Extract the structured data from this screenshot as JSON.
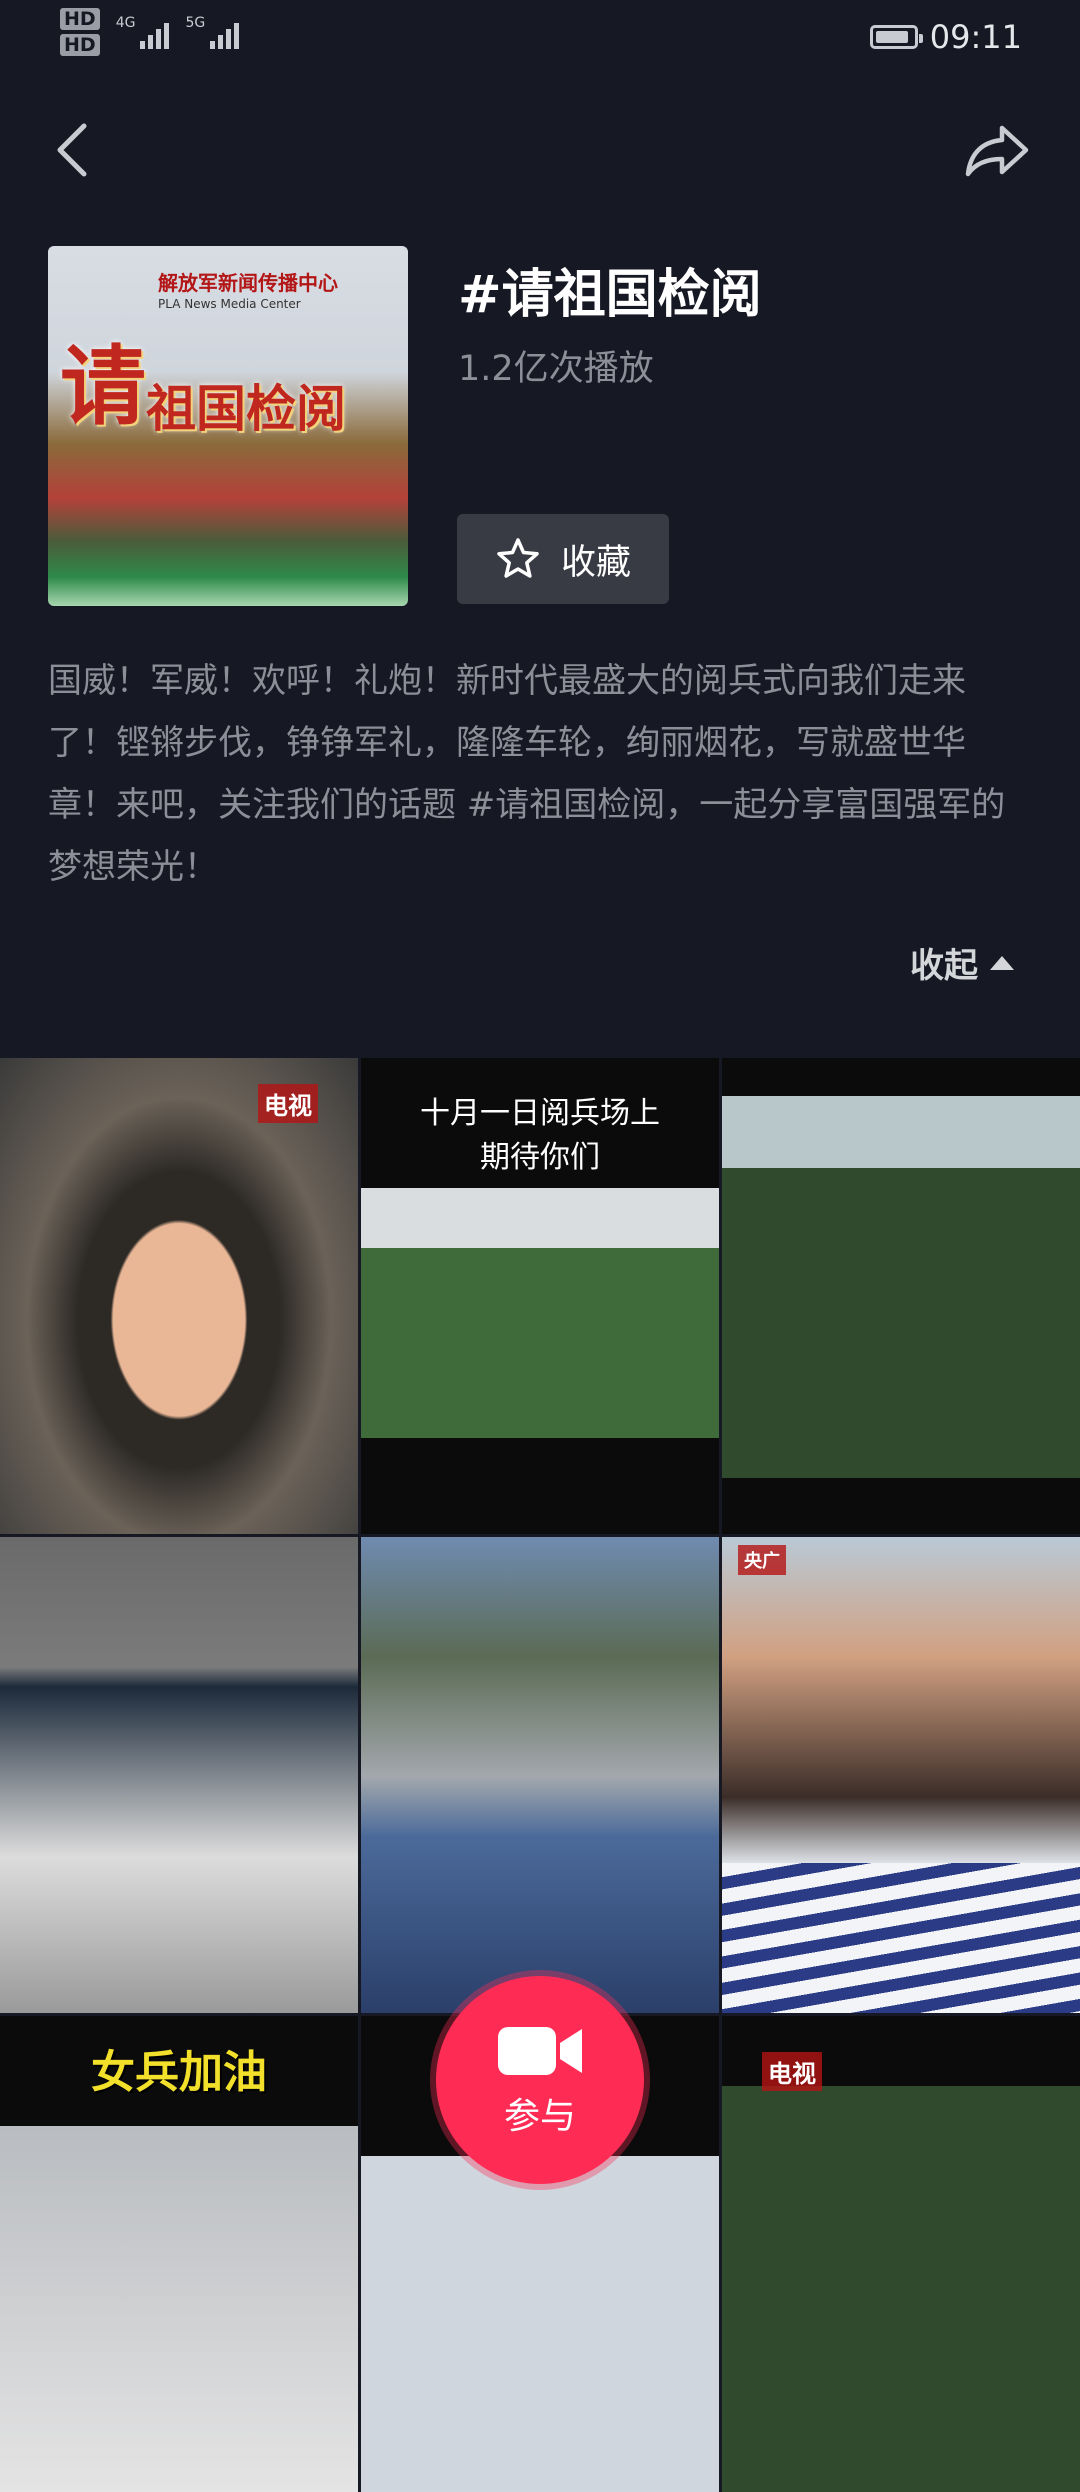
{
  "status_bar": {
    "network_1": "4G",
    "network_2": "5G",
    "time": "09:11",
    "hd_labels": [
      "HD",
      "HD"
    ]
  },
  "nav": {
    "back_icon": "chevron-left-icon",
    "share_icon": "share-arrow-icon"
  },
  "topic": {
    "cover_logo": "解放军新闻传播中心",
    "cover_logo_sub": "PLA News Media Center",
    "cover_big_char": "请",
    "cover_big_rest": "祖国检阅",
    "title": "#请祖国检阅",
    "plays": "1.2亿次播放",
    "favorite_label": "收藏",
    "favorite_icon": "star-outline-icon",
    "description": "国威！军威！欢呼！礼炮！新时代最盛大的阅兵式向我们走来了！铿锵步伐，铮铮军礼，隆隆车轮，绚丽烟花，写就盛世华章！来吧，关注我们的话题 #请祖国检阅，一起分享富国强军的梦想荣光！",
    "collapse_label": "收起"
  },
  "grid": {
    "tile_captions": {
      "t1_tag": "电视",
      "t2_caption_line1": "十月一日阅兵场上",
      "t2_caption_line2": "期待你们",
      "t6_tag": "央广",
      "t7_caption": "女兵加油",
      "t9_tag": "电视"
    }
  },
  "join_button": {
    "label": "参与",
    "icon": "video-camera-icon",
    "color": "#fe2c55"
  },
  "colors": {
    "background": "#161823",
    "secondary_text": "#8c8e98",
    "button_bg": "#393b44"
  }
}
